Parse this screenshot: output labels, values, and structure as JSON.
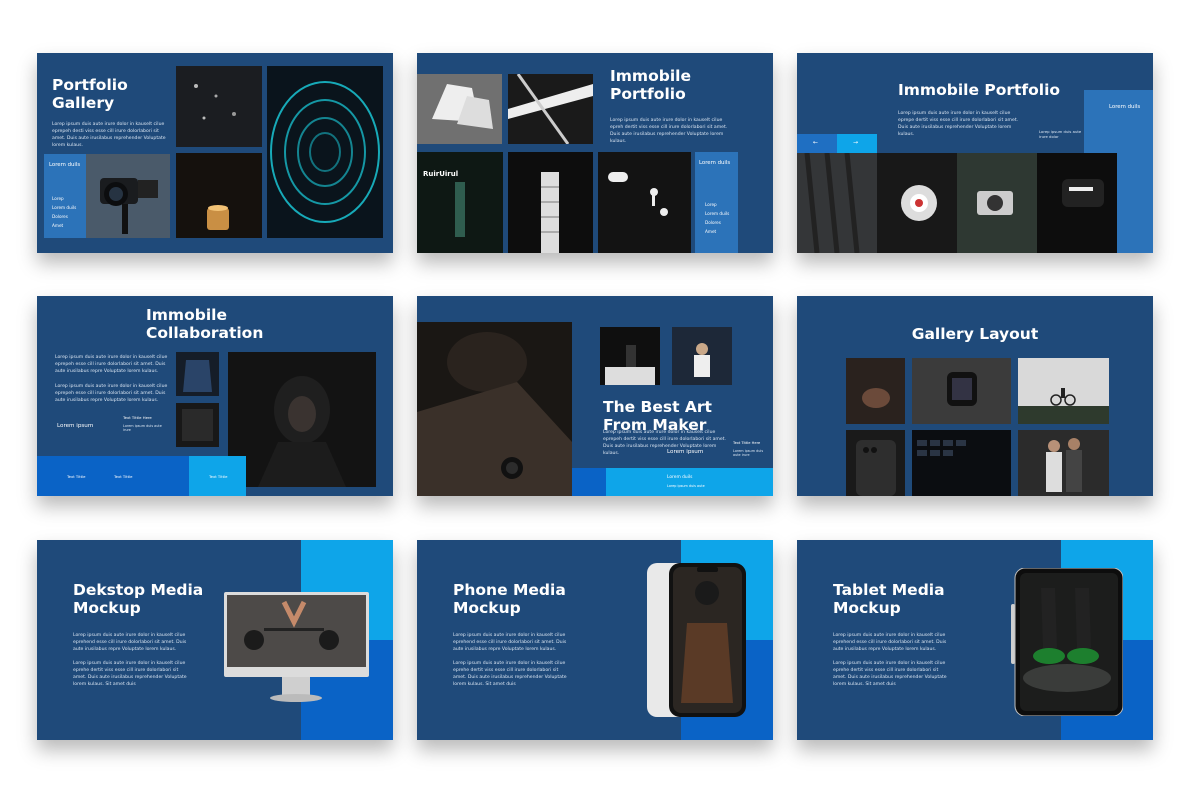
{
  "slides": {
    "s1": {
      "title": "Portfolio\nGallery",
      "body": "Lorep ipsum duis aute irure dolor in kauselt cilue eprepeh desti viss esse cill irure dolorlabori sit amet. Duis aute irusilabus reprehender Voluptate lorem kulaus.",
      "box_title": "Lorem duils",
      "items": [
        "Lorep",
        "Lorem duils",
        "Dolores",
        "Amet"
      ]
    },
    "s2": {
      "title": "Immobile\nPortfolio",
      "body": "Lorep ipsum duis aute irure dolor in kauselt cilue epreh dertit viss esse cill irure dolorlabori sit amet. Duis aute irusilabus reprehender Voluptate lorem kulaus.",
      "box_title": "Lorem duils",
      "items": [
        "Lorep",
        "Lorem duils",
        "Dolores",
        "Amet"
      ],
      "sign_text": "RuirUirul"
    },
    "s3": {
      "title": "Immobile Portfolio",
      "body": "Lorep ipsum duis aute irure dolor in kauselt cilue eprepe dertit viss esse cill irure dolorlabori sit amet. Duis aute irusilabus reprehender Voluptate lorem kulaus.",
      "box_title": "Lorem duils",
      "box_small": "Lorep ipsum duis aute irure dolor",
      "nav_left": "←",
      "nav_right": "→"
    },
    "s4": {
      "title": "Immobile\nCollaboration",
      "body1": "Lorep ipsum duis aute irure dolor in kauselt cilue eprepeh esse cill irure dolorlabori sit amet. Duis aute irusilabus repre Voluptate lorem kulaus.",
      "body2": "Lorep ipsum duis aute irure dolor in kauselt cilue eprepeh esse cill irure dolorlabori sit amet. Duis aute irusilabus repre Voluptate lorem kulaus.",
      "label": "Lorem ipsum",
      "mini_title": "Text Tittle Here",
      "mini_body": "Lorem ipsum duis aute irure",
      "tab1": "Text Tittle",
      "tab2": "Text Tittle",
      "tab3": "Text Tittle"
    },
    "s5": {
      "title": "The Best Art\nFrom Maker",
      "body": "Lorep ipsum duis aute irure dolor in kauselt cilue eprepeh dertit viss esse cill irure dolorlabori sit amet. Duis aute irusilabus reprehender Voluptate lorem kulaus.",
      "label": "Lorem ipsum",
      "mini_title": "Text Tittle Here",
      "mini_body": "Lorem ipsum duis aute irure",
      "bar_label": "Lorem duils",
      "bar_small": "Lorep ipsum duis aute"
    },
    "s6": {
      "title": "Gallery Layout"
    },
    "s7": {
      "title": "Dekstop Media\nMockup",
      "body1": "Lorep ipsum duis aute irure dolor in kauselt cilue eprehend esse cill irure dolorlabori sit amet. Duis aute irusilabus repre Voluptate lorem kulaus.",
      "body2": "Lorep ipsum duis aute irure dolor in kauselt cilue eprehe dertit viss esse cill irure dolorlabori sit amet. Duis aute irusilabus reprehender Voluptate lorem kulaus. Sit amet duis"
    },
    "s8": {
      "title": "Phone Media\nMockup",
      "body1": "Lorep ipsum duis aute irure dolor in kauselt cilue eprehend esse cill irure dolorlabori sit amet. Duis aute irusilabus repre Voluptate lorem kulaus.",
      "body2": "Lorep ipsum duis aute irure dolor in kauselt cilue eprehe dertit viss esse cill irure dolorlabori sit amet. Duis aute irusilabus reprehender Voluptate lorem kulaus. Sit amet duis"
    },
    "s9": {
      "title": "Tablet Media\nMockup",
      "body1": "Lorep ipsum duis aute irure dolor in kauselt cilue eprehend esse cill irure dolorlabori sit amet. Duis aute irusilabus repre Voluptate lorem kulaus.",
      "body2": "Lorep ipsum duis aute irure dolor in kauselt cilue eprehe dertit viss esse cill irure dolorlabori sit amet. Duis aute irusilabus reprehender Voluptate lorem kulaus. Sit amet duis"
    }
  }
}
